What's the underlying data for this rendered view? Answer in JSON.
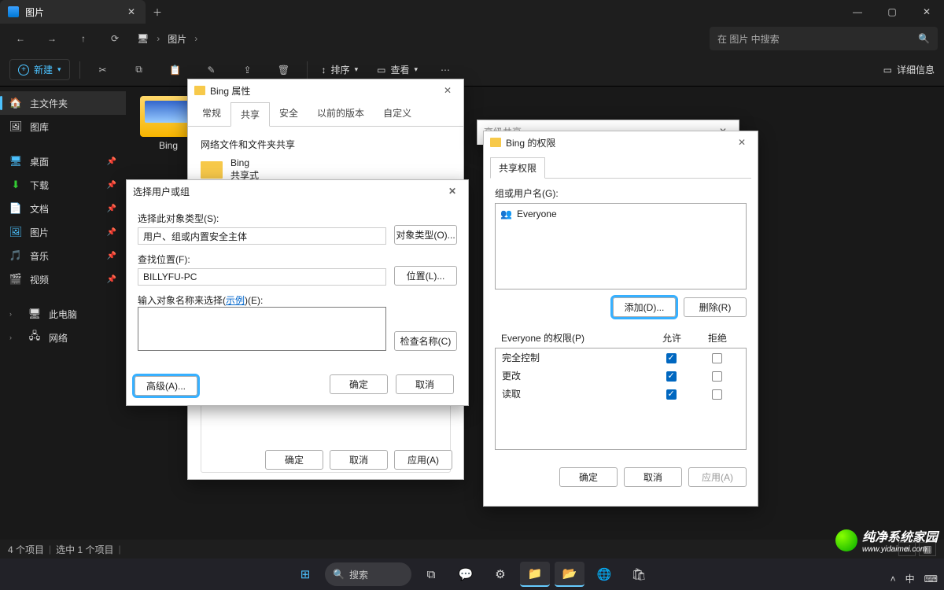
{
  "titlebar": {
    "tab_title": "图片"
  },
  "breadcrumb": {
    "root_icon": "🖥",
    "item1": "图片"
  },
  "search": {
    "placeholder": "在 图片 中搜索"
  },
  "toolbar": {
    "new_label": "新建",
    "sort_label": "排序",
    "view_label": "查看",
    "details_label": "详细信息"
  },
  "sidebar": {
    "home": "主文件夹",
    "gallery": "图库",
    "desktop": "桌面",
    "downloads": "下载",
    "documents": "文档",
    "pictures": "图片",
    "music": "音乐",
    "videos": "视频",
    "thispc": "此电脑",
    "network": "网络"
  },
  "content": {
    "folder_name": "Bing"
  },
  "statusbar": {
    "count": "4 个项目",
    "selected": "选中 1 个项目"
  },
  "taskbar": {
    "search": "搜索",
    "ime": "中"
  },
  "prop_dialog": {
    "title": "Bing 属性",
    "tabs": {
      "general": "常规",
      "share": "共享",
      "security": "安全",
      "prev": "以前的版本",
      "custom": "自定义"
    },
    "section_title": "网络文件和文件夹共享",
    "obj_name": "Bing",
    "obj_state": "共享式",
    "ok": "确定",
    "cancel": "取消",
    "apply": "应用(A)"
  },
  "adv_share": {
    "title": "高级共享"
  },
  "select_dialog": {
    "title": "选择用户或组",
    "obj_type_label": "选择此对象类型(S):",
    "obj_type_value": "用户、组或内置安全主体",
    "obj_type_btn": "对象类型(O)...",
    "location_label": "查找位置(F):",
    "location_value": "BILLYFU-PC",
    "location_btn": "位置(L)...",
    "names_label_pre": "输入对象名称来选择(",
    "names_label_link": "示例",
    "names_label_post": ")(E):",
    "check_btn": "检查名称(C)",
    "advanced_btn": "高级(A)...",
    "ok": "确定",
    "cancel": "取消"
  },
  "perm_dialog": {
    "title": "Bing 的权限",
    "tab": "共享权限",
    "group_label": "组或用户名(G):",
    "everyone": "Everyone",
    "add_btn": "添加(D)...",
    "remove_btn": "删除(R)",
    "perm_for": "Everyone 的权限(P)",
    "allow": "允许",
    "deny": "拒绝",
    "full": "完全控制",
    "change": "更改",
    "read": "读取",
    "ok": "确定",
    "cancel": "取消",
    "apply": "应用(A)"
  },
  "watermark": {
    "line1": "纯净系统家园",
    "line2": "www.yidaimei.com"
  }
}
